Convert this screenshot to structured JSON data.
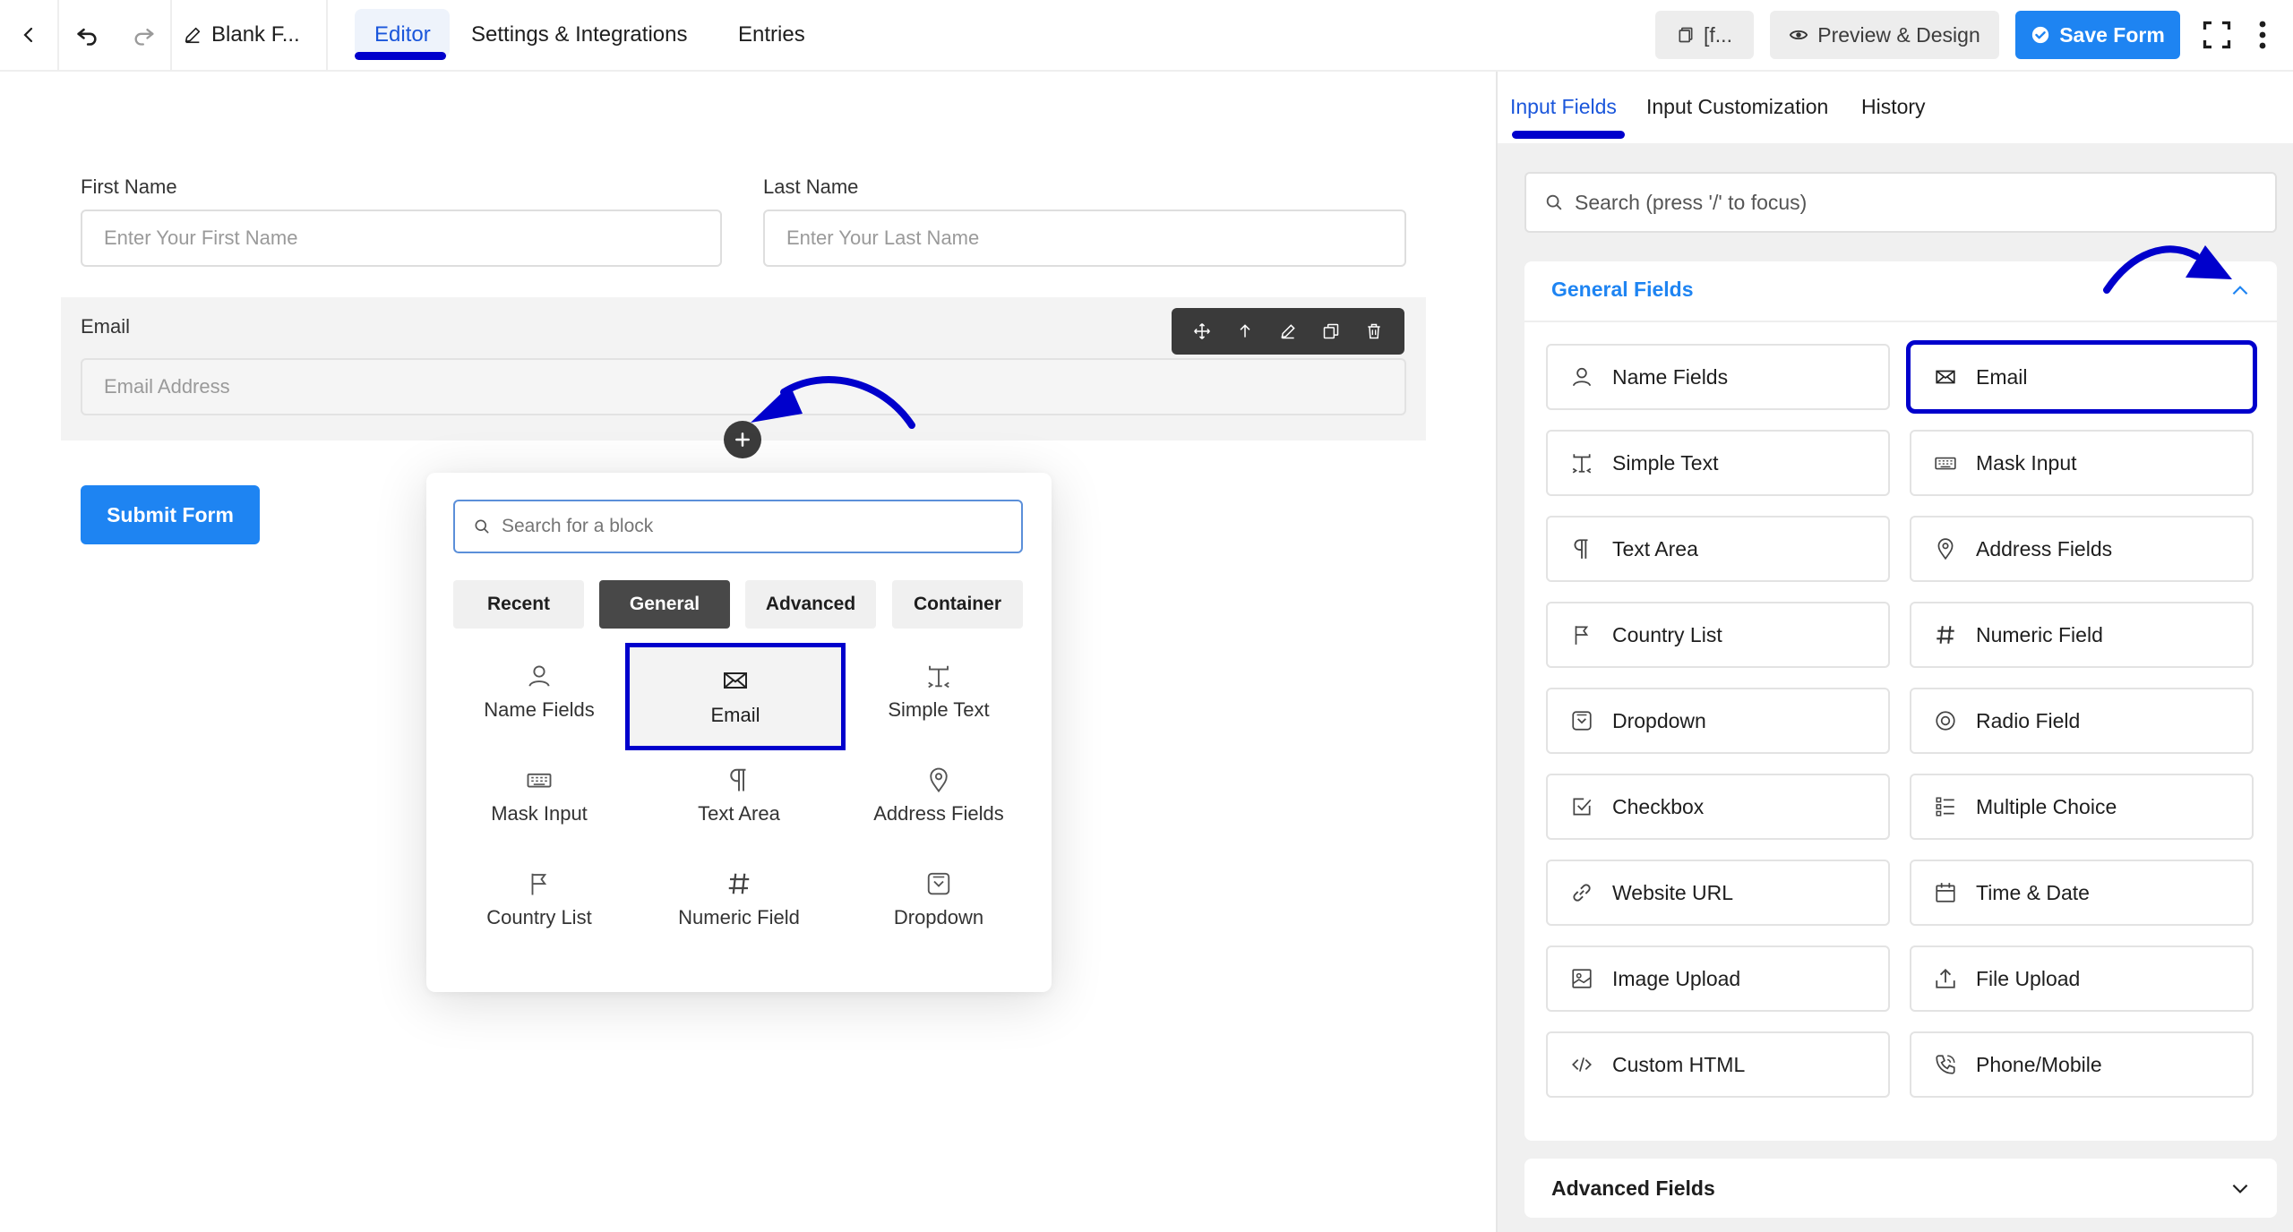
{
  "topbar": {
    "doc_title": "Blank F...",
    "tabs": [
      {
        "label": "Editor"
      },
      {
        "label": "Settings & Integrations"
      },
      {
        "label": "Entries"
      }
    ],
    "shortcode_label": "[f...",
    "preview_label": "Preview & Design",
    "save_label": "Save Form"
  },
  "form": {
    "first_name_label": "First Name",
    "first_name_placeholder": "Enter Your First Name",
    "last_name_label": "Last Name",
    "last_name_placeholder": "Enter Your Last Name",
    "email_label": "Email",
    "email_placeholder": "Email Address",
    "submit_label": "Submit Form"
  },
  "inserter": {
    "search_placeholder": "Search for a block",
    "tabs": [
      "Recent",
      "General",
      "Advanced",
      "Container"
    ],
    "active_tab": "General",
    "items": [
      {
        "label": "Name Fields",
        "icon": "user-icon"
      },
      {
        "label": "Email",
        "icon": "envelope-icon"
      },
      {
        "label": "Simple Text",
        "icon": "text-cursor-icon"
      },
      {
        "label": "Mask Input",
        "icon": "keyboard-icon"
      },
      {
        "label": "Text Area",
        "icon": "pilcrow-icon"
      },
      {
        "label": "Address Fields",
        "icon": "map-pin-icon"
      },
      {
        "label": "Country List",
        "icon": "flag-icon"
      },
      {
        "label": "Numeric Field",
        "icon": "hash-icon"
      },
      {
        "label": "Dropdown",
        "icon": "dropdown-icon"
      }
    ]
  },
  "sidebar": {
    "tabs": [
      "Input Fields",
      "Input Customization",
      "History"
    ],
    "search_placeholder": "Search (press '/' to focus)",
    "general_title": "General Fields",
    "advanced_title": "Advanced Fields",
    "fields": [
      {
        "label": "Name Fields",
        "icon": "user-icon"
      },
      {
        "label": "Email",
        "icon": "envelope-icon"
      },
      {
        "label": "Simple Text",
        "icon": "text-cursor-icon"
      },
      {
        "label": "Mask Input",
        "icon": "keyboard-icon"
      },
      {
        "label": "Text Area",
        "icon": "pilcrow-icon"
      },
      {
        "label": "Address Fields",
        "icon": "map-pin-icon"
      },
      {
        "label": "Country List",
        "icon": "flag-icon"
      },
      {
        "label": "Numeric Field",
        "icon": "hash-icon"
      },
      {
        "label": "Dropdown",
        "icon": "dropdown-icon"
      },
      {
        "label": "Radio Field",
        "icon": "radio-icon"
      },
      {
        "label": "Checkbox",
        "icon": "checkbox-icon"
      },
      {
        "label": "Multiple Choice",
        "icon": "list-icon"
      },
      {
        "label": "Website URL",
        "icon": "link-icon"
      },
      {
        "label": "Time & Date",
        "icon": "calendar-icon"
      },
      {
        "label": "Image Upload",
        "icon": "image-icon"
      },
      {
        "label": "File Upload",
        "icon": "upload-icon"
      },
      {
        "label": "Custom HTML",
        "icon": "code-icon"
      },
      {
        "label": "Phone/Mobile",
        "icon": "phone-icon"
      }
    ]
  },
  "colors": {
    "accent": "#1e84f2",
    "link": "#1a56db",
    "highlight": "#0000cc"
  }
}
